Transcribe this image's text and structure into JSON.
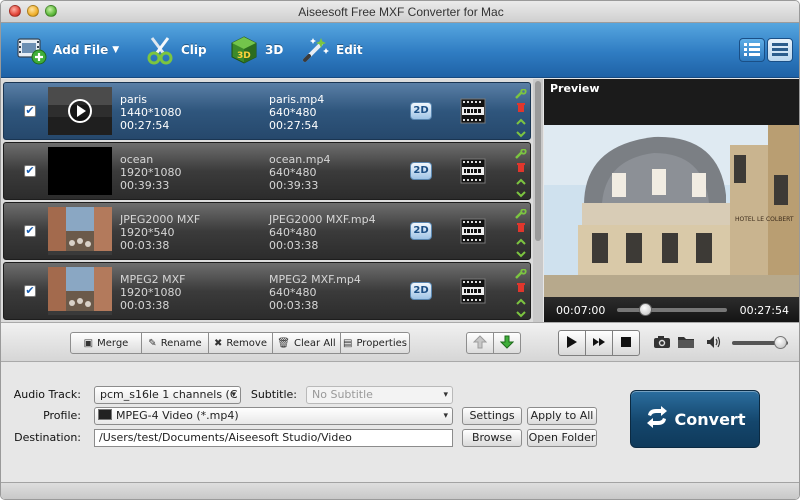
{
  "window": {
    "title": "Aiseesoft Free MXF Converter for Mac"
  },
  "toolbar": {
    "add_file": "Add File",
    "clip": "Clip",
    "three_d": "3D",
    "edit": "Edit"
  },
  "files": [
    {
      "name": "paris",
      "resolution": "1440*1080",
      "duration": "00:27:54",
      "out_name": "paris.mp4",
      "out_resolution": "640*480",
      "out_duration": "00:27:54",
      "badge": "2D",
      "format_icon": "mpeg4-film-icon",
      "checked": true,
      "selected": true
    },
    {
      "name": "ocean",
      "resolution": "1920*1080",
      "duration": "00:39:33",
      "out_name": "ocean.mp4",
      "out_resolution": "640*480",
      "out_duration": "00:39:33",
      "badge": "2D",
      "format_icon": "mpeg4-film-icon",
      "checked": true,
      "selected": false
    },
    {
      "name": "JPEG2000 MXF",
      "resolution": "1920*540",
      "duration": "00:03:38",
      "out_name": "JPEG2000 MXF.mp4",
      "out_resolution": "640*480",
      "out_duration": "00:03:38",
      "badge": "2D",
      "format_icon": "mpeg4-film-icon",
      "checked": true,
      "selected": false
    },
    {
      "name": "MPEG2 MXF",
      "resolution": "1920*1080",
      "duration": "00:03:38",
      "out_name": "MPEG2 MXF.mp4",
      "out_resolution": "640*480",
      "out_duration": "00:03:38",
      "badge": "2D",
      "format_icon": "mpeg4-film-icon",
      "checked": true,
      "selected": false
    }
  ],
  "listbar": {
    "merge": "Merge",
    "rename": "Rename",
    "remove": "Remove",
    "clear_all": "Clear All",
    "properties": "Properties"
  },
  "preview": {
    "label": "Preview",
    "sign_text": "HOTEL LE COLBERT",
    "time_current": "00:07:00",
    "time_total": "00:27:54",
    "seek_fraction": 0.25,
    "volume_fraction": 0.85
  },
  "settings": {
    "audio_track_label": "Audio Track:",
    "audio_track_value": "pcm_s16le 1 channels (C",
    "subtitle_label": "Subtitle:",
    "subtitle_value": "No Subtitle",
    "profile_label": "Profile:",
    "profile_value": "MPEG-4 Video (*.mp4)",
    "destination_label": "Destination:",
    "destination_value": "/Users/test/Documents/Aiseesoft Studio/Video",
    "settings_btn": "Settings",
    "apply_all_btn": "Apply to All",
    "browse_btn": "Browse",
    "open_folder_btn": "Open Folder",
    "convert_btn": "Convert"
  },
  "colors": {
    "toolbar_blue": "#2f7cc2",
    "selected_row": "#2f567d",
    "convert": "#14466c"
  }
}
